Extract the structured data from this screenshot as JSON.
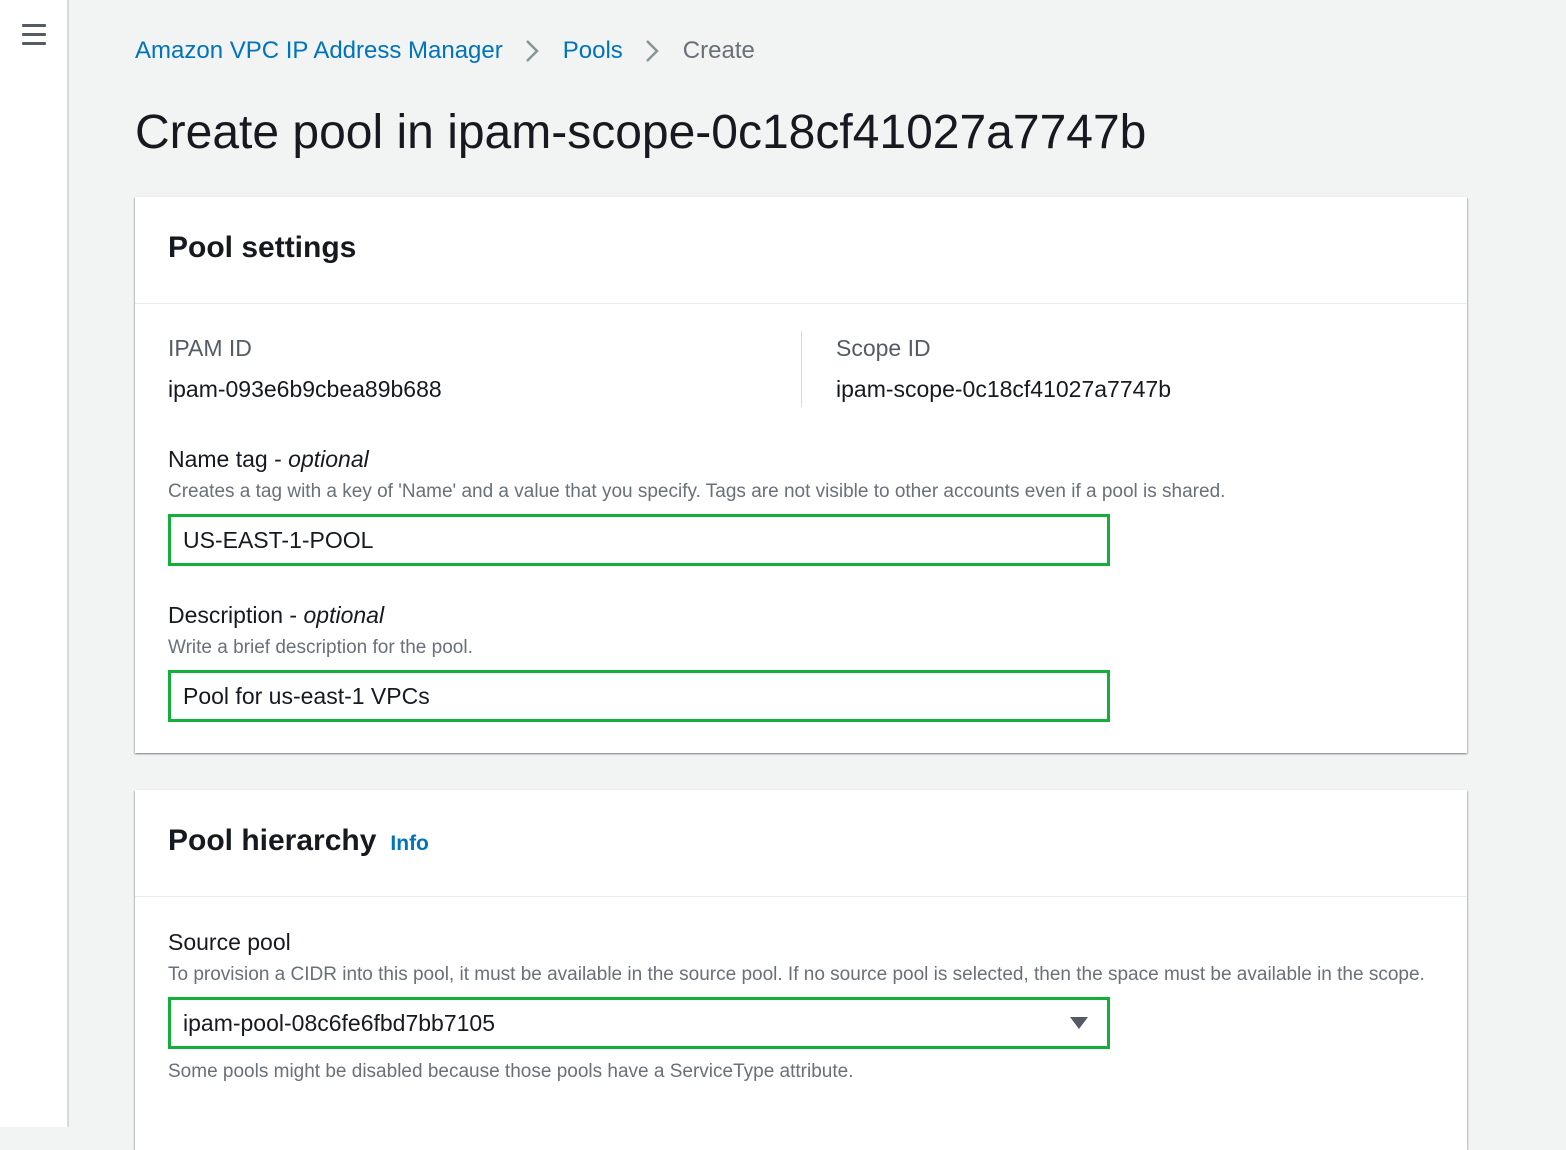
{
  "nav": {
    "menu_icon": "hamburger-menu-icon"
  },
  "breadcrumb": {
    "items": [
      "Amazon VPC IP Address Manager",
      "Pools",
      "Create"
    ],
    "separator_icon": "chevron-right-icon"
  },
  "page": {
    "title": "Create pool in ipam-scope-0c18cf41027a7747b"
  },
  "pool_settings": {
    "title": "Pool settings",
    "ipam_id_label": "IPAM ID",
    "ipam_id_value": "ipam-093e6b9cbea89b688",
    "scope_id_label": "Scope ID",
    "scope_id_value": "ipam-scope-0c18cf41027a7747b",
    "name_tag": {
      "label": "Name tag - ",
      "optional": "optional",
      "description": "Creates a tag with a key of 'Name' and a value that you specify. Tags are not visible to other accounts even if a pool is shared.",
      "value": "US-EAST-1-POOL"
    },
    "description_field": {
      "label": "Description - ",
      "optional": "optional",
      "description": "Write a brief description for the pool.",
      "value": "Pool for us-east-1 VPCs"
    }
  },
  "pool_hierarchy": {
    "title": "Pool hierarchy",
    "info_link": "Info",
    "source_pool": {
      "label": "Source pool",
      "description": "To provision a CIDR into this pool, it must be available in the source pool. If no source pool is selected, then the space must be available in the scope.",
      "selected": "ipam-pool-08c6fe6fbd7bb7105",
      "hint": "Some pools might be disabled because those pools have a ServiceType attribute."
    }
  },
  "colors": {
    "link": "#0073bb",
    "highlight_border": "#12b03a",
    "background": "#f2f3f3"
  }
}
